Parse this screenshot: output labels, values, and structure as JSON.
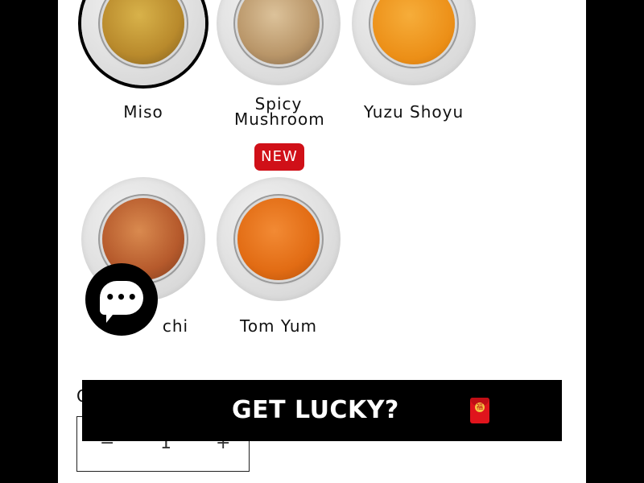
{
  "flavors": [
    {
      "label": "Miso",
      "selected": true,
      "fill": "#cfa53f"
    },
    {
      "label": "Spicy Mushroom",
      "selected": false,
      "fill": "#c89c64"
    },
    {
      "label": "Yuzu Shoyu",
      "selected": false,
      "fill": "#ef9b23"
    },
    {
      "label": "Kimchi",
      "label_visible": "chi",
      "selected": false,
      "fill": "#c56b35"
    },
    {
      "label": "Tom Yum",
      "selected": false,
      "fill": "#ea7d23"
    }
  ],
  "badge": {
    "text": "NEW"
  },
  "chat": {
    "dots": "•••"
  },
  "quantity": {
    "label": "Q",
    "minus": "−",
    "value": "1",
    "plus": "+"
  },
  "banner": {
    "text": "GET LUCKY?",
    "icon": "red-envelope-icon",
    "seal_text": "福"
  },
  "colors": {
    "badge": "#d01018",
    "banner_bg": "#000000",
    "page_bg": "#ffffff"
  }
}
